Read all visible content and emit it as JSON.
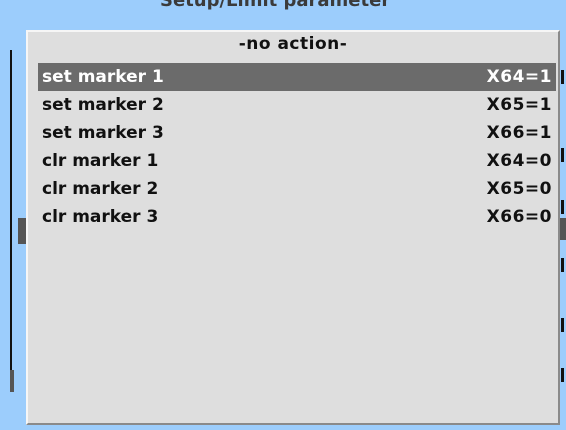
{
  "background": {
    "title": "Setup/Limit parameter"
  },
  "menu": {
    "title": "-no action-",
    "items": [
      {
        "label": "set marker 1",
        "code": "X64=1",
        "selected": true
      },
      {
        "label": "set marker 2",
        "code": "X65=1",
        "selected": false
      },
      {
        "label": "set marker 3",
        "code": "X66=1",
        "selected": false
      },
      {
        "label": "clr marker 1",
        "code": "X64=0",
        "selected": false
      },
      {
        "label": "clr marker 2",
        "code": "X65=0",
        "selected": false
      },
      {
        "label": "clr marker 3",
        "code": "X66=0",
        "selected": false
      }
    ]
  },
  "colors": {
    "background": "#9ccdfc",
    "popup": "#dedede",
    "selection": "#6b6b6b"
  }
}
